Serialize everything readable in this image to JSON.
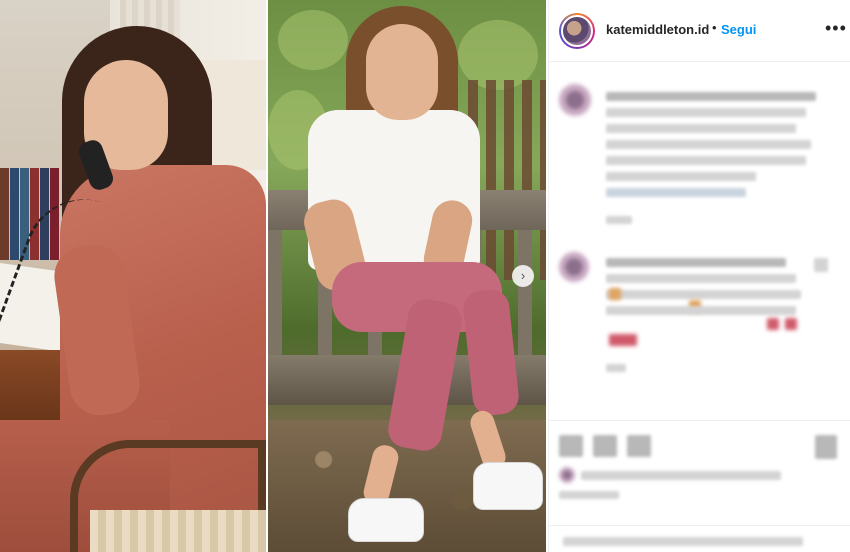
{
  "post": {
    "account": {
      "username": "katemiddleton.id",
      "bullet": "•",
      "follow_label": "Segui",
      "more_icon": "more-options-icon"
    },
    "carousel": {
      "next_icon": "›"
    }
  },
  "colors": {
    "follow_blue": "#0095f6",
    "text": "#262626",
    "border": "#efefef"
  }
}
